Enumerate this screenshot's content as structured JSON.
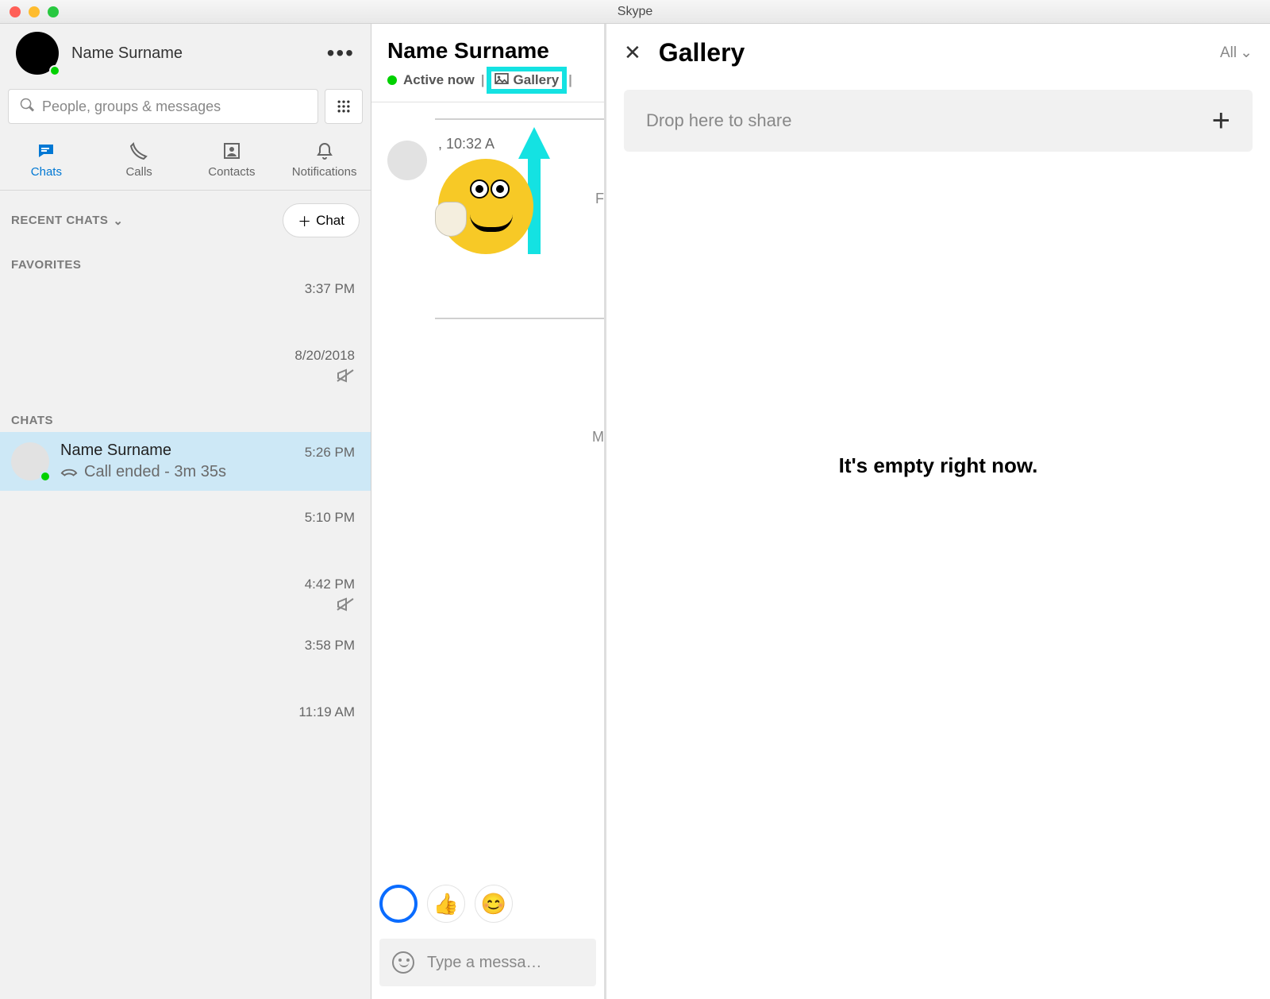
{
  "window": {
    "title": "Skype"
  },
  "me": {
    "name": "Name Surname"
  },
  "search": {
    "placeholder": "People, groups & messages"
  },
  "tabs": {
    "chats": "Chats",
    "calls": "Calls",
    "contacts": "Contacts",
    "notifications": "Notifications"
  },
  "sections": {
    "recent": "RECENT CHATS",
    "favorites": "FAVORITES",
    "chats": "CHATS"
  },
  "newchat": {
    "label": "Chat"
  },
  "timeline": {
    "fav_time": "3:37 PM",
    "date1": "8/20/2018",
    "t2": "5:10 PM",
    "t3": "4:42 PM",
    "t4": "3:58 PM",
    "t5": "11:19 AM"
  },
  "active_chat": {
    "name": "Name Surname",
    "subtitle": "Call ended - 3m 35s",
    "time": "5:26 PM"
  },
  "conversation": {
    "title": "Name Surname",
    "status": "Active now",
    "gallery_btn": "Gallery",
    "msg_time": ", 10:32 A",
    "edge1": "F",
    "edge2": "M",
    "compose_placeholder": "Type a messa…"
  },
  "gallery": {
    "title": "Gallery",
    "filter": "All",
    "drop_label": "Drop here to share",
    "empty": "It's empty right now."
  }
}
